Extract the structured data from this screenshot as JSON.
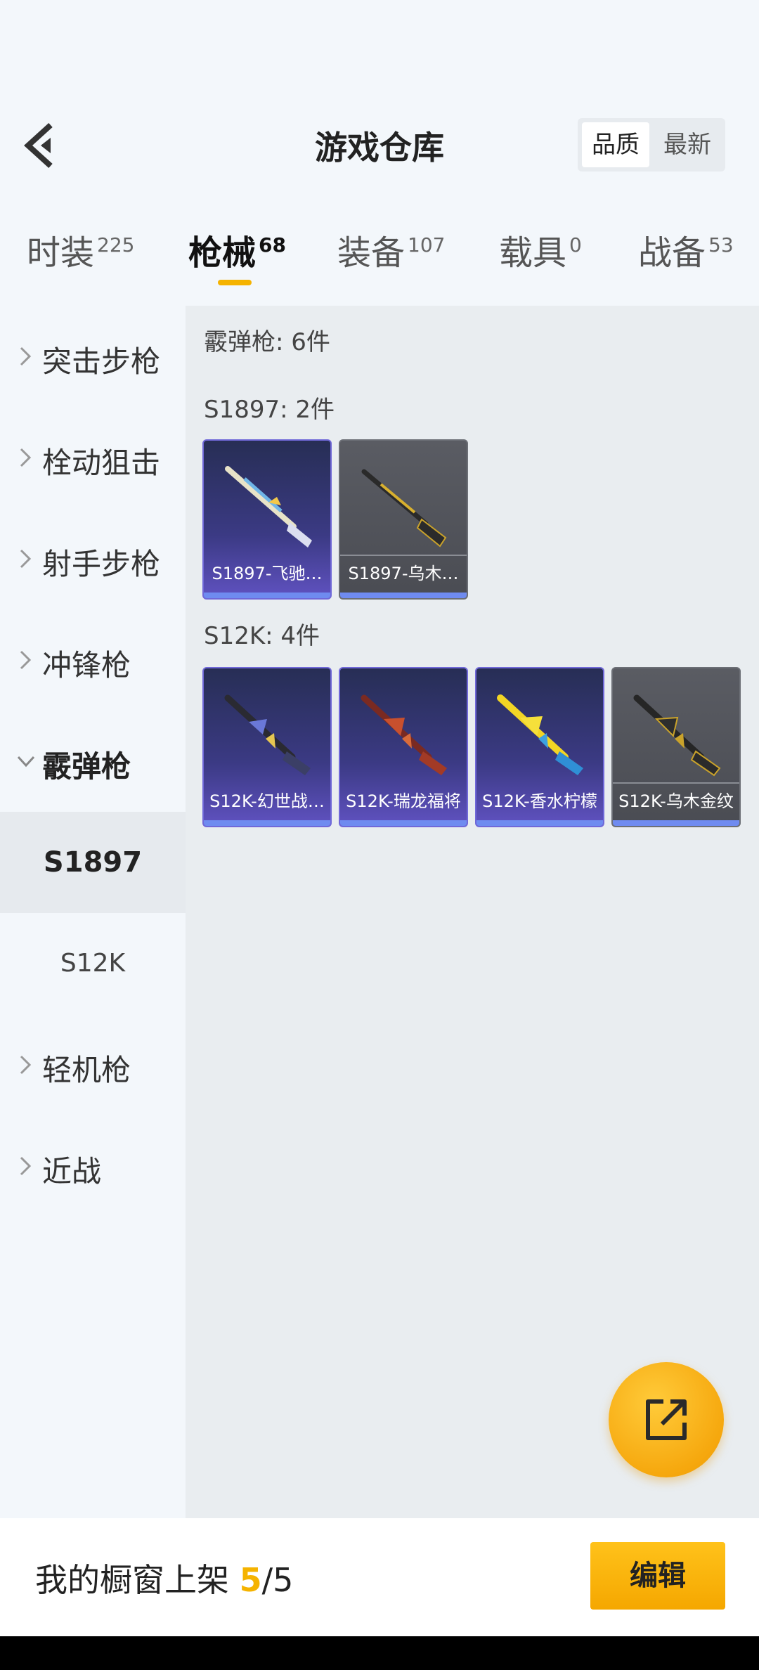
{
  "header": {
    "title": "游戏仓库",
    "sort": {
      "quality": "品质",
      "newest": "最新",
      "selected": "品质"
    }
  },
  "tabs": [
    {
      "label": "时装",
      "count": "225"
    },
    {
      "label": "枪械",
      "count": "68",
      "active": true
    },
    {
      "label": "装备",
      "count": "107"
    },
    {
      "label": "载具",
      "count": "0"
    },
    {
      "label": "战备",
      "count": "53"
    }
  ],
  "sidebar": {
    "items": [
      {
        "label": "突击步枪"
      },
      {
        "label": "栓动狙击"
      },
      {
        "label": "射手步枪"
      },
      {
        "label": "冲锋枪"
      },
      {
        "label": "霰弹枪",
        "expanded": true
      },
      {
        "label": "轻机枪"
      },
      {
        "label": "近战"
      }
    ],
    "subitems": [
      {
        "label": "S1897",
        "active": true
      },
      {
        "label": "S12K"
      }
    ]
  },
  "content": {
    "category_title": "霰弹枪: 6件",
    "groups": [
      {
        "title": "S1897: 2件",
        "items": [
          {
            "name": "S1897-飞驰…",
            "rarity": "purple"
          },
          {
            "name": "S1897-乌木…",
            "rarity": "gray"
          }
        ]
      },
      {
        "title": "S12K: 4件",
        "items": [
          {
            "name": "S12K-幻世战…",
            "rarity": "purple"
          },
          {
            "name": "S12K-瑞龙福将",
            "rarity": "purple"
          },
          {
            "name": "S12K-香水柠檬",
            "rarity": "purple"
          },
          {
            "name": "S12K-乌木金纹",
            "rarity": "gray"
          }
        ]
      }
    ]
  },
  "footer": {
    "label": "我的橱窗上架 ",
    "count": "5",
    "total": "/5",
    "edit": "编辑"
  },
  "colors": {
    "accent": "#f5b300",
    "purple_rarity": "#6052c1",
    "gray_rarity": "#5a5c63"
  }
}
